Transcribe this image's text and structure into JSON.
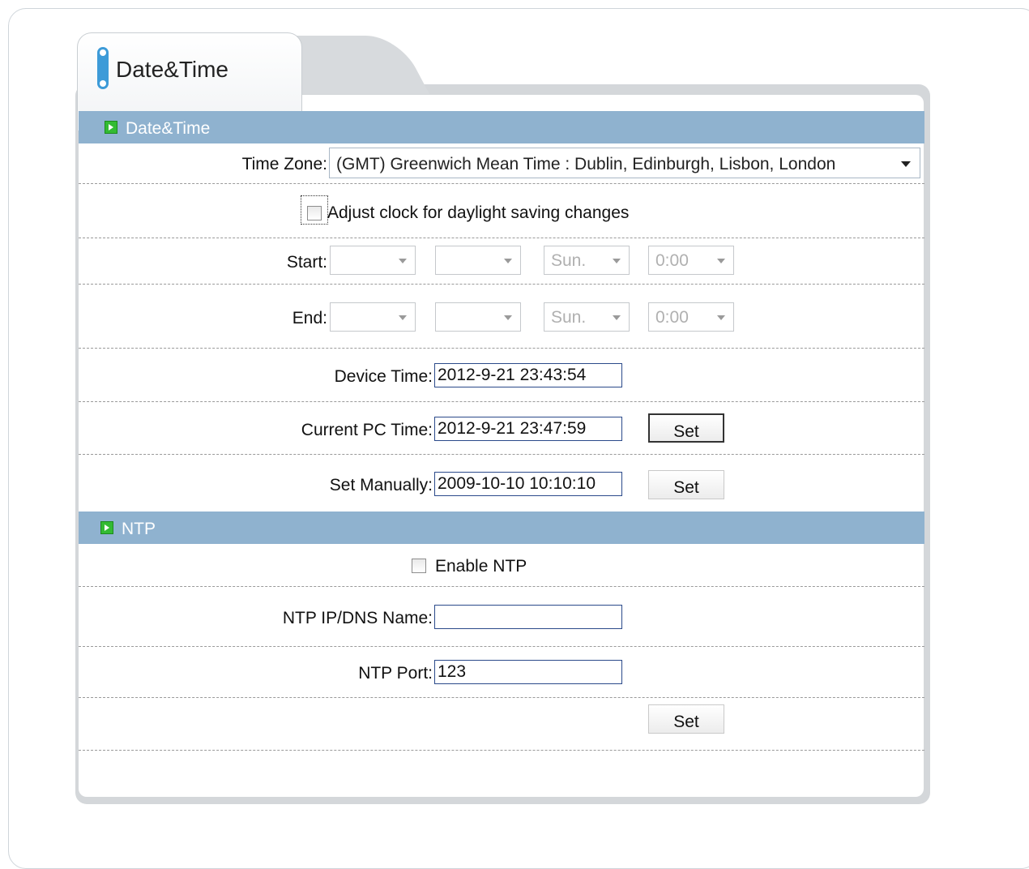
{
  "tab": {
    "title": "Date&Time"
  },
  "sections": {
    "datetime": "Date&Time",
    "ntp": "NTP"
  },
  "timezone": {
    "label": "Time Zone:",
    "value": "(GMT) Greenwich Mean Time : Dublin, Edinburgh, Lisbon, London"
  },
  "daylight": {
    "label": "Adjust clock for daylight saving changes",
    "checked": false
  },
  "start": {
    "label": "Start:",
    "week": "",
    "month": "",
    "day": "Sun.",
    "time": "0:00"
  },
  "end": {
    "label": "End:",
    "week": "",
    "month": "",
    "day": "Sun.",
    "time": "0:00"
  },
  "device_time": {
    "label": "Device Time:",
    "value": "2012-9-21 23:43:54"
  },
  "pc_time": {
    "label": "Current PC Time:",
    "value": "2012-9-21 23:47:59",
    "button": "Set"
  },
  "manual_time": {
    "label": "Set Manually:",
    "value": "2009-10-10 10:10:10",
    "button": "Set"
  },
  "ntp": {
    "enable_label": "Enable NTP",
    "enabled": false,
    "server_label": "NTP IP/DNS Name:",
    "server_value": "",
    "port_label": "NTP Port:",
    "port_value": "123",
    "button": "Set"
  },
  "icons": {
    "tab": "tab-pill-icon",
    "section": "section-arrow-icon",
    "dropdown": "chevron-down-icon"
  },
  "colors": {
    "section_header": "#8fb2cf",
    "section_icon": "#33bb33",
    "tab_accent": "#3d9bd8",
    "panel": "#d4d7da"
  }
}
